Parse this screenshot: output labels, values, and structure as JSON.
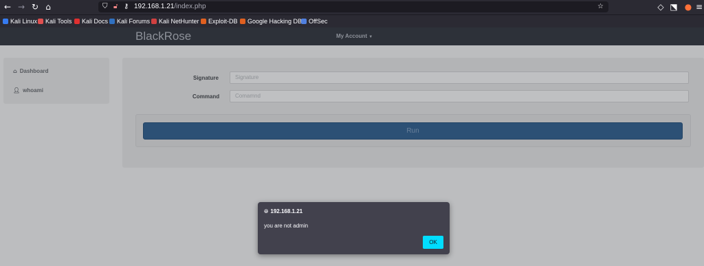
{
  "browser": {
    "url_host": "192.168.1.21",
    "url_path": "/index.php",
    "bookmarks": [
      {
        "label": "Kali Linux",
        "color": "#367bf0"
      },
      {
        "label": "Kali Tools",
        "color": "#e05050"
      },
      {
        "label": "Kali Docs",
        "color": "#e03030"
      },
      {
        "label": "Kali Forums",
        "color": "#3070c0"
      },
      {
        "label": "Kali NetHunter",
        "color": "#d04040"
      },
      {
        "label": "Exploit-DB",
        "color": "#e06020"
      },
      {
        "label": "Google Hacking DB",
        "color": "#e06020"
      },
      {
        "label": "OffSec",
        "color": "#5080e0"
      }
    ]
  },
  "site": {
    "brand": "BlackRose",
    "account_menu": "My Account",
    "sidebar": {
      "items": [
        {
          "label": "Dashboard",
          "icon": "home-icon"
        },
        {
          "label": "whoami",
          "icon": "user-icon"
        }
      ]
    },
    "form": {
      "signature_label": "Signature",
      "signature_placeholder": "Signature",
      "command_label": "Command",
      "command_placeholder": "Comamnd",
      "run_label": "Run"
    }
  },
  "alert": {
    "origin": "192.168.1.21",
    "message": "you are not admin",
    "ok_label": "OK"
  }
}
